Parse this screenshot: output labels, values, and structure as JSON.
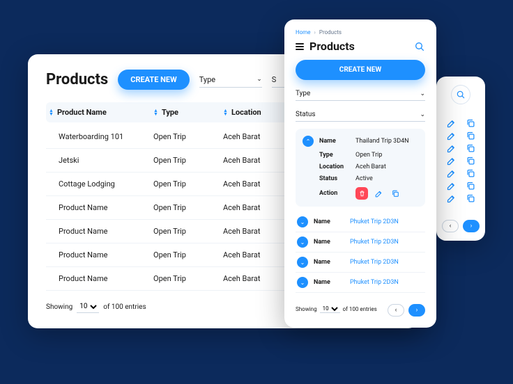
{
  "desktop": {
    "title": "Products",
    "create": "CREATE NEW",
    "type_label": "Type",
    "status_label_initial": "S",
    "cols": {
      "name": "Product Name",
      "type": "Type",
      "location": "Location"
    },
    "rows": [
      {
        "name": "Waterboarding 101",
        "type": "Open Trip",
        "location": "Aceh Barat"
      },
      {
        "name": "Jetski",
        "type": "Open Trip",
        "location": "Aceh Barat"
      },
      {
        "name": "Cottage Lodging",
        "type": "Open Trip",
        "location": "Aceh Barat"
      },
      {
        "name": "Product Name",
        "type": "Open Trip",
        "location": "Aceh Barat"
      },
      {
        "name": "Product Name",
        "type": "Open Trip",
        "location": "Aceh Barat"
      },
      {
        "name": "Product Name",
        "type": "Open Trip",
        "location": "Aceh Barat"
      },
      {
        "name": "Product Name",
        "type": "Open Trip",
        "location": "Aceh Barat"
      }
    ],
    "pager": {
      "showing": "Showing",
      "size": "10",
      "of": "of 100 entries"
    }
  },
  "mobile": {
    "crumb_home": "Home",
    "crumb_cur": "Products",
    "title": "Products",
    "create": "CREATE NEW",
    "type_label": "Type",
    "status_label": "Status",
    "expanded": {
      "name_l": "Name",
      "name_v": "Thailand Trip 3D4N",
      "type_l": "Type",
      "type_v": "Open Trip",
      "loc_l": "Location",
      "loc_v": "Aceh Barat",
      "status_l": "Status",
      "status_v": "Active",
      "action_l": "Action"
    },
    "collapsed": [
      {
        "name_l": "Name",
        "link": "Phuket Trip 2D3N"
      },
      {
        "name_l": "Name",
        "link": "Phuket Trip 2D3N"
      },
      {
        "name_l": "Name",
        "link": "Phuket Trip 2D3N"
      },
      {
        "name_l": "Name",
        "link": "Phuket Trip 2D3N"
      }
    ],
    "pager": {
      "showing": "Showing",
      "size": "10",
      "of": "of 100 entries"
    }
  }
}
